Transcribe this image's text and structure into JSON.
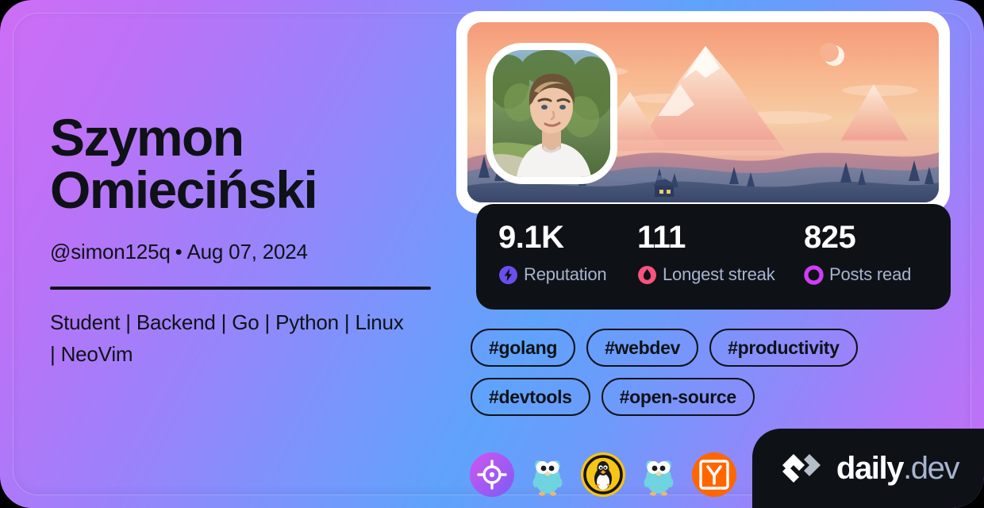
{
  "theme": {
    "gradient_start": "#cd6ef6",
    "gradient_mid": "#5fa3fb",
    "gradient_end": "#c56ef6",
    "ink": "#0e1217",
    "muted": "#a8b3cf",
    "reputation_color": "#6b4ef0",
    "streak_color": "#f9537d",
    "posts_color": "#cf3df5"
  },
  "profile": {
    "display_name": "Szymon Omieciński",
    "handle": "@simon125q",
    "separator": "•",
    "joined_date": "Aug 07, 2024",
    "bio": "Student | Backend | Go | Python | Linux | NeoVim",
    "avatar_name": "avatar-photo",
    "cover_name": "cover-mountain-sunset"
  },
  "stats": [
    {
      "value": "9.1K",
      "label": "Reputation",
      "icon": "bolt-icon",
      "color": "#6b4ef0"
    },
    {
      "value": "111",
      "label": "Longest streak",
      "icon": "flame-icon",
      "color": "#f9537d"
    },
    {
      "value": "825",
      "label": "Posts read",
      "icon": "ring-icon",
      "color": "#cf3df5"
    }
  ],
  "tags": [
    {
      "label": "#golang"
    },
    {
      "label": "#webdev"
    },
    {
      "label": "#productivity"
    },
    {
      "label": "#devtools"
    },
    {
      "label": "#open-source"
    }
  ],
  "badges": [
    {
      "icon": "target-badge-icon",
      "title": "target"
    },
    {
      "icon": "gopher-badge-icon",
      "title": "go"
    },
    {
      "icon": "linux-badge-icon",
      "title": "linux"
    },
    {
      "icon": "gopher-badge-icon",
      "title": "go"
    },
    {
      "icon": "hackernews-badge-icon",
      "title": "hacker-news"
    }
  ],
  "branding": {
    "name": "daily",
    "tld": ".dev",
    "logo_icon": "daily-dev-logo-icon"
  }
}
